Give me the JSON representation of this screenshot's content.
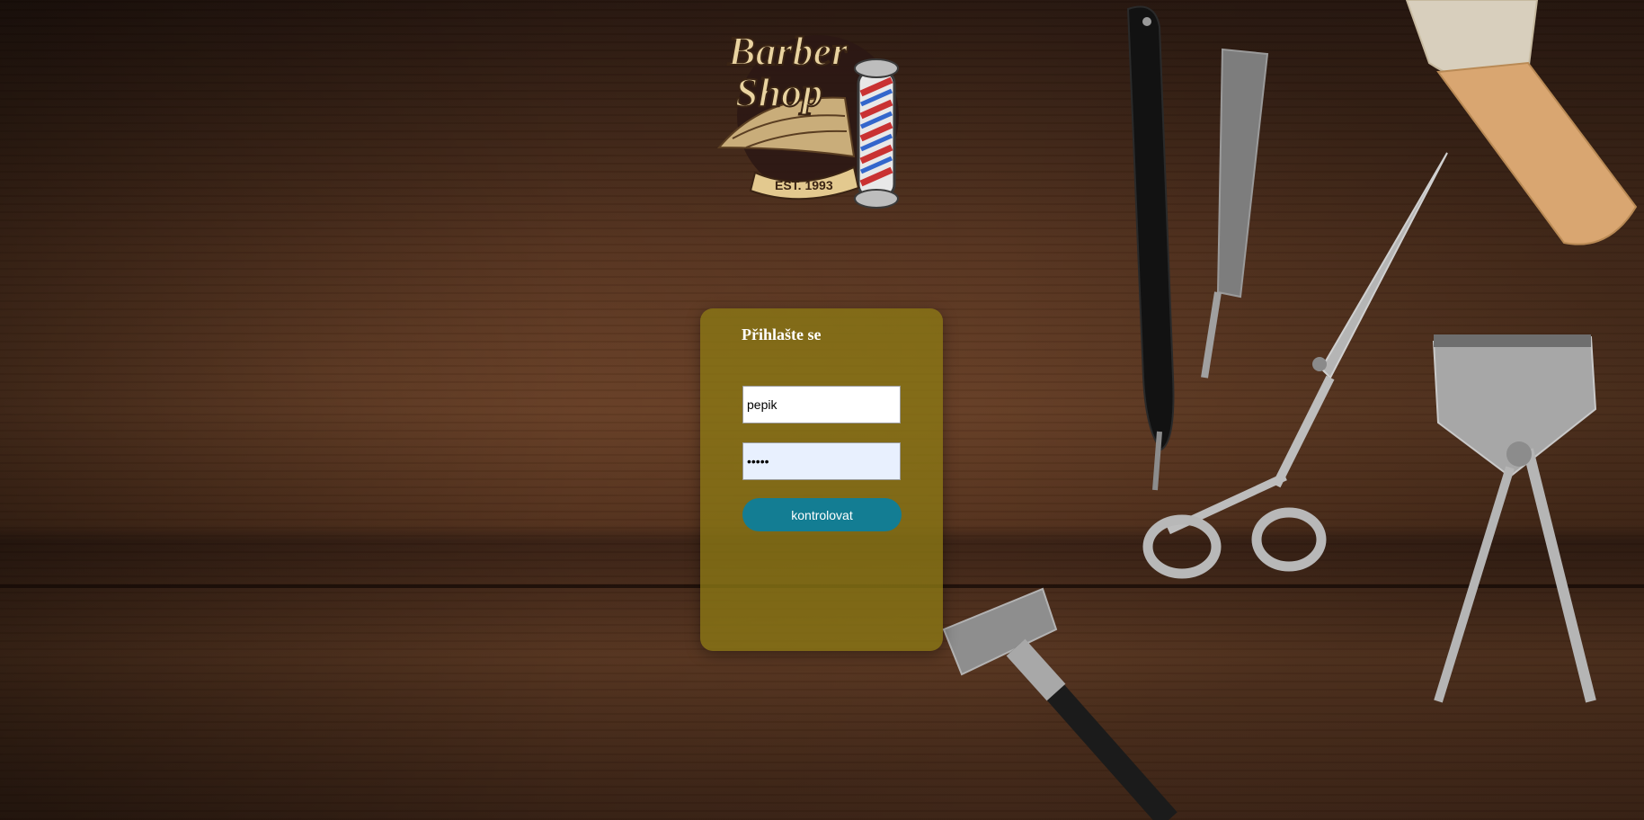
{
  "logo": {
    "line1": "Barber",
    "line2": "Shop",
    "est": "EST. 1993"
  },
  "login": {
    "title": "Přihlašte se",
    "username_value": "pepik",
    "password_value": "•••••",
    "submit_label": "kontrolovat"
  },
  "colors": {
    "panel": "#8c7814",
    "button": "#137d93",
    "autofill_field": "#e8f0fe"
  },
  "icons": [
    "barber-pole-icon",
    "wings-icon",
    "scissors-icon",
    "straight-razor-icon",
    "shaving-brush-icon",
    "hair-clipper-icon",
    "safety-razor-icon"
  ]
}
